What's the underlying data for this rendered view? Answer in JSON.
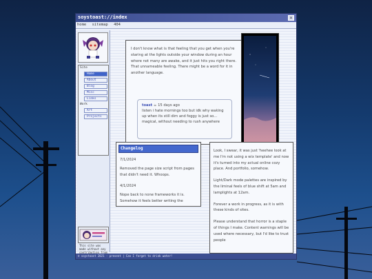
{
  "window": {
    "title": "soystoast://index",
    "close_glyph": "×"
  },
  "nav": [
    "home",
    "sitemap",
    "404"
  ],
  "sidebar": {
    "site_label": "Site",
    "site_items": [
      "Home",
      "About",
      "Blog",
      "Misc",
      "Links"
    ],
    "work_label": "Work",
    "work_items": [
      "Art",
      "Projects"
    ],
    "active_item": "Home",
    "ai_notice": "This site was made without any contribution from a Generative AI."
  },
  "intro": {
    "text": "I don't know what is that feeling that you get when you're staring at the lights outside your window during an hour where not many are awake, and it just hits you right there. That unnameable feeling. There might be a word for it in another language.",
    "comment": {
      "user": "toast",
      "time": "15 days ago",
      "body": "listen i hate mornings too but idk why waking up when its still dim and foggy is just so... magical, without needing to rush anywhere"
    }
  },
  "changelog": {
    "title": "Changelog",
    "entries": [
      {
        "date": "7/1/2024",
        "text": "Removed the page size script from pages that didn't need it. Whoops."
      },
      {
        "date": "4/1/2024",
        "text": "Nope back to none frameworks it is. Somehow it feels better writing the"
      }
    ]
  },
  "about": {
    "paragraphs": [
      "Look, I swear, it was just 'heehee look at me I'm not using a wix template' and now it's turned into my actual online cozy place. And portfolio, somehow.",
      "Light/Dark mode palettes are inspired by the liminal feels of blue shift at 5am and lamplights at 12am.",
      "Forever a work in progress, as it is with these kinds of sites.",
      "Please understand that horror is a staple of things I make. Content warnings will be used where necessary, but I'd like to trust people"
    ]
  },
  "footer": "© soystoast 2021 - present | Can I forget to drink water!",
  "colors": {
    "accent": "#4468cd",
    "titlebar": "#3c4e91",
    "sky": "#143a6d"
  }
}
